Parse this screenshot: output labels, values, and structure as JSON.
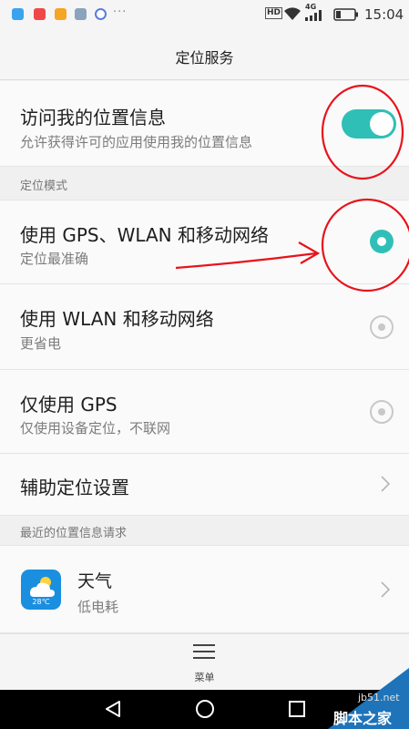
{
  "status_bar": {
    "dots": "···",
    "hd_label": "HD",
    "network_label": "4G",
    "time": "15:04"
  },
  "header": {
    "title": "定位服务"
  },
  "location_access": {
    "title": "访问我的位置信息",
    "subtitle": "允许获得许可的应用使用我的位置信息",
    "enabled": true
  },
  "mode_section": {
    "label": "定位模式"
  },
  "modes": [
    {
      "title": "使用 GPS、WLAN 和移动网络",
      "subtitle": "定位最准确",
      "selected": true
    },
    {
      "title": "使用 WLAN 和移动网络",
      "subtitle": "更省电",
      "selected": false
    },
    {
      "title": "仅使用 GPS",
      "subtitle": "仅使用设备定位，不联网",
      "selected": false
    }
  ],
  "assist": {
    "title": "辅助定位设置"
  },
  "recent_section": {
    "label": "最近的位置信息请求"
  },
  "recent_apps": [
    {
      "name": "天气",
      "usage": "低电耗",
      "icon_text": "28℃",
      "icon": "weather-icon"
    }
  ],
  "bottom_menu": {
    "label": "菜单",
    "icon": "menu-icon"
  },
  "watermark": {
    "url": "jb51.net",
    "text": "脚本之家"
  },
  "colors": {
    "accent": "#2fbfb6",
    "annotation_red": "#e8131b",
    "weather_blue": "#1a8fe0"
  }
}
